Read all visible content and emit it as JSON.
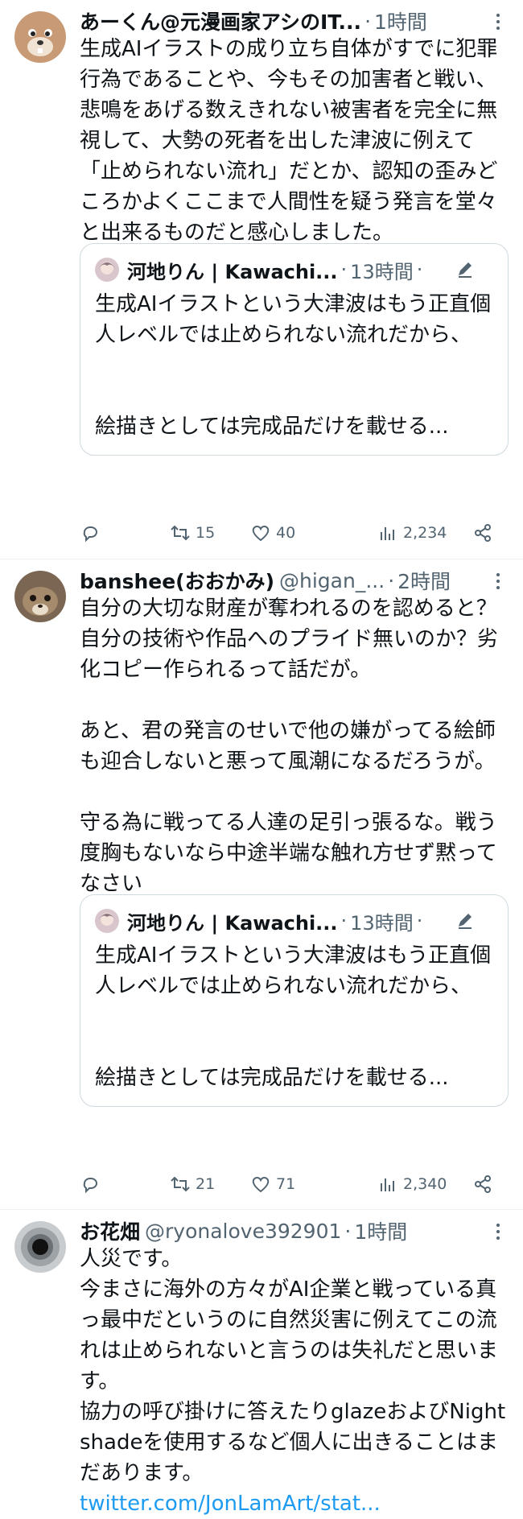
{
  "tweets": [
    {
      "name": "あーくん@元漫画家アシのIT...",
      "handle": "",
      "time": "1時間",
      "text": "生成AIイラストの成り立ち自体がすでに犯罪行為であることや、今もその加害者と戦い、悲鳴をあげる数えきれない被害者を完全に無視して、大勢の死者を出した津波に例えて「止められない流れ」だとか、認知の歪みどころかよくここまで人間性を疑う発言を堂々と出来るものだと感心しました。",
      "quote": {
        "name": "河地りん | Kawachi...",
        "time": "13時間",
        "text": "生成AIイラストという大津波はもう正直個人レベルでは止められない流れだから、",
        "last_line": "絵描きとしては完成品だけを載せる..."
      },
      "stats": {
        "retweets": "15",
        "likes": "40",
        "views": "2,234"
      }
    },
    {
      "name": "banshee(おおかみ)",
      "handle": "@higan_...",
      "time": "2時間",
      "text": "自分の大切な財産が奪われるのを認めると？自分の技術や作品へのプライド無いのか？劣化コピー作られるって話だが。\n\nあと、君の発言のせいで他の嫌がってる絵師も迎合しないと悪って風潮になるだろうが。\n\n守る為に戦ってる人達の足引っ張るな。戦う度胸もないなら中途半端な触れ方せず黙ってなさい",
      "quote": {
        "name": "河地りん | Kawachi...",
        "time": "13時間",
        "text": "生成AIイラストという大津波はもう正直個人レベルでは止められない流れだから、",
        "last_line": "絵描きとしては完成品だけを載せる..."
      },
      "stats": {
        "retweets": "21",
        "likes": "71",
        "views": "2,340"
      }
    },
    {
      "name": "お花畑",
      "handle": "@ryonalove392901",
      "time": "1時間",
      "text": "人災です。\n今まさに海外の方々がAI企業と戦っている真っ最中だというのに自然災害に例えてこの流れは止められないと言うのは失礼だと思います。\n協力の呼び掛けに答えたりglazeおよびNightshadeを使用するなど個人に出きることはまだあります。",
      "link": "twitter.com/JonLamArt/stat..."
    }
  ],
  "icons": {
    "reply": "reply-icon",
    "retweet": "retweet-icon",
    "like": "heart-icon",
    "views": "views-icon",
    "share": "share-icon",
    "more": "more-icon",
    "edited": "pencil-icon"
  },
  "colors": {
    "text": "#0f1419",
    "muted": "#536471",
    "link": "#1d9bf0",
    "border": "#cfd9de"
  }
}
